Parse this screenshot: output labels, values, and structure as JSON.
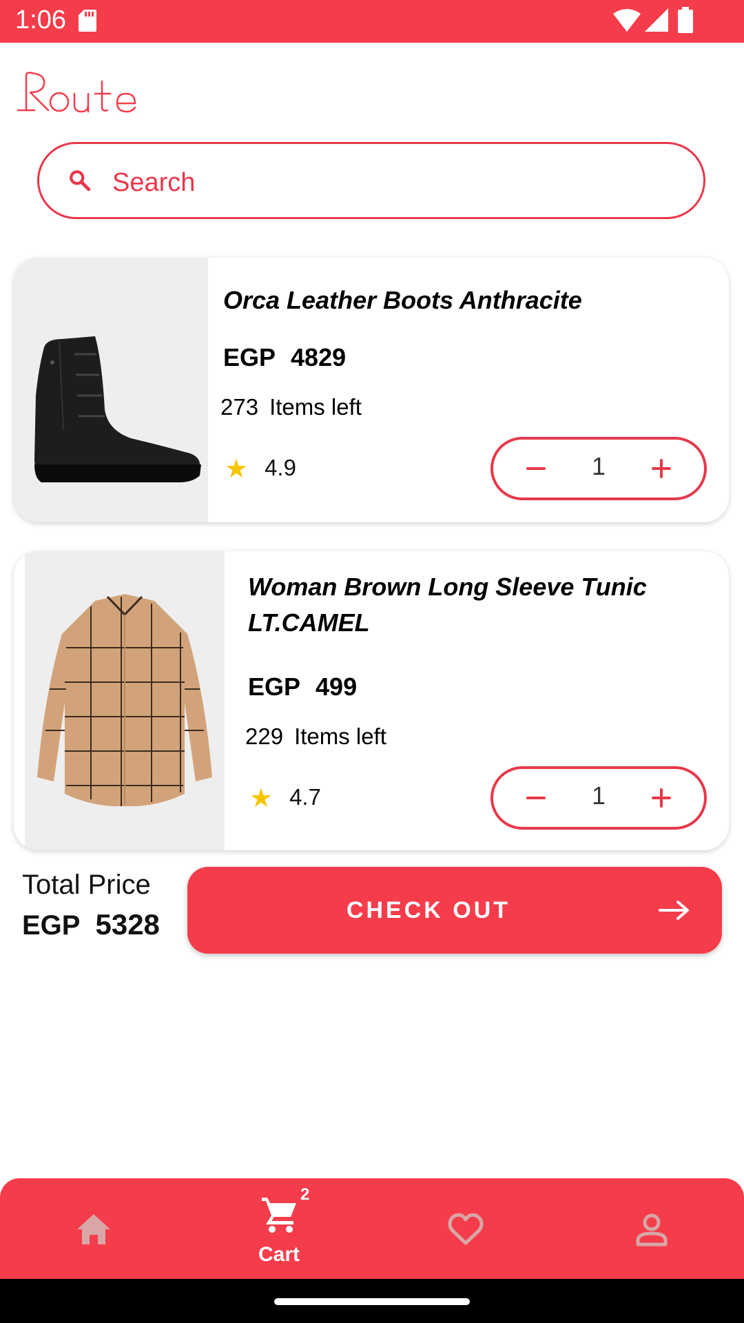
{
  "status_bar": {
    "time": "1:06"
  },
  "header": {
    "logo_text": "Route"
  },
  "search": {
    "placeholder": "Search"
  },
  "cart_items": [
    {
      "title": "Orca Leather Boots Anthracite",
      "currency": "EGP",
      "price": "4829",
      "stock_count": "273",
      "stock_label": "Items left",
      "rating": "4.9",
      "quantity": "1"
    },
    {
      "title": "Woman Brown Long Sleeve Tunic LT.CAMEL",
      "currency": "EGP",
      "price": "499",
      "stock_count": "229",
      "stock_label": "Items left",
      "rating": "4.7",
      "quantity": "1"
    }
  ],
  "summary": {
    "total_label": "Total Price",
    "currency": "EGP",
    "total_value": "5328",
    "checkout_label": "CHECK OUT"
  },
  "bottom_nav": {
    "items": [
      {
        "icon": "home-icon",
        "label": ""
      },
      {
        "icon": "cart-icon",
        "label": "Cart",
        "badge": "2"
      },
      {
        "icon": "heart-icon",
        "label": ""
      },
      {
        "icon": "person-icon",
        "label": ""
      }
    ],
    "active": "Cart"
  },
  "colors": {
    "primary": "#F53C4B",
    "outline": "#E8384A",
    "star": "#F7C600"
  }
}
